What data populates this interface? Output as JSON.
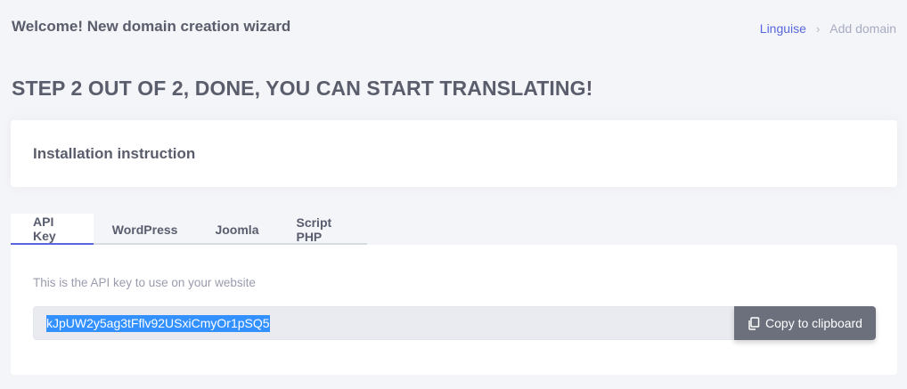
{
  "header": {
    "title": "Welcome! New domain creation wizard",
    "breadcrumb": {
      "link": "Linguise",
      "current": "Add domain"
    }
  },
  "step_title": "STEP 2 OUT OF 2, DONE, YOU CAN START TRANSLATING!",
  "install_card": {
    "title": "Installation instruction"
  },
  "tabs": [
    {
      "label": "API Key",
      "active": true
    },
    {
      "label": "WordPress",
      "active": false
    },
    {
      "label": "Joomla",
      "active": false
    },
    {
      "label": "Script PHP",
      "active": false
    }
  ],
  "api_panel": {
    "description": "This is the API key to use on your website",
    "api_key": "kJpUW2y5ag3tFflv92USxiCmyOr1pSQ5",
    "copy_label": "Copy to clipboard",
    "copy_icon": "copy-icon"
  },
  "colors": {
    "accent": "#5867dd",
    "copy_button": "#6c707d",
    "selection": "#3390ff"
  }
}
